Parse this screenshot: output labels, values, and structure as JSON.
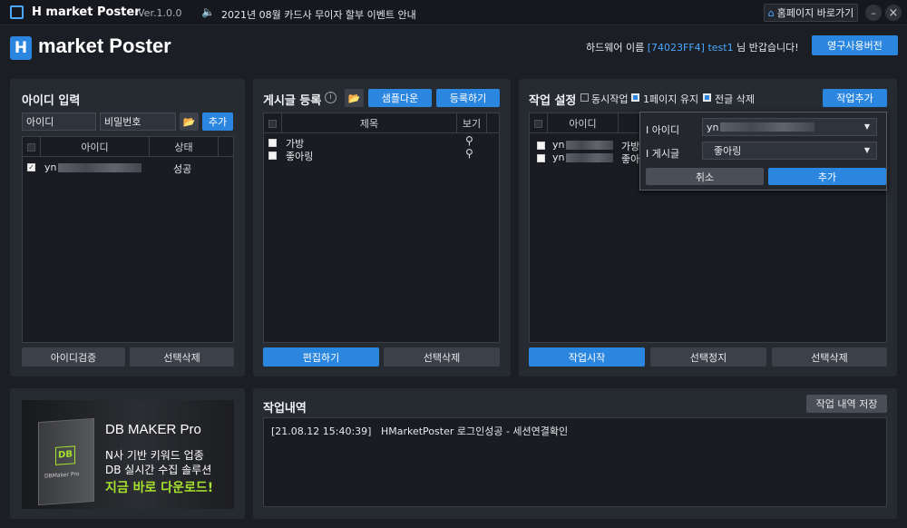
{
  "titlebar": {
    "app_name": "H market Poster",
    "version": "Ver.1.0.0",
    "notice": "2021년 08월 카드사 무이자 할부 이벤트 안내",
    "homepage_button": "홈페이지 바로가기",
    "minimize": "–",
    "close": "×"
  },
  "header": {
    "logo_text": "market Poster",
    "hardware_label": "하드웨어 이름",
    "hardware_id": "[74023FF4]",
    "username": "test1",
    "greeting": "님 반갑습니다!",
    "license_button": "영구사용버전"
  },
  "id_panel": {
    "title": "아이디 입력",
    "id_placeholder": "아이디",
    "pw_placeholder": "비밀번호",
    "add_button": "추가",
    "columns": [
      "아이디",
      "상태"
    ],
    "rows": [
      {
        "id": "yn",
        "status": "성공",
        "checked": true
      }
    ],
    "verify_button": "아이디검증",
    "delete_button": "선택삭제"
  },
  "post_panel": {
    "title": "게시글 등록",
    "sample_button": "샘플다운",
    "register_button": "등록하기",
    "columns": [
      "제목",
      "보기"
    ],
    "rows": [
      "가방",
      "좋아링"
    ],
    "edit_button": "편집하기",
    "delete_button": "선택삭제"
  },
  "task_panel": {
    "title": "작업 설정",
    "options": [
      {
        "label": "동시작업",
        "checked": false
      },
      {
        "label": "1페이지 유지",
        "checked": true
      },
      {
        "label": "전글 삭제",
        "checked": true
      }
    ],
    "add_task_button": "작업추가",
    "columns": [
      "아이디"
    ],
    "rows": [
      {
        "id": "yn",
        "post": "가방"
      },
      {
        "id": "yn",
        "post": "좋아"
      }
    ],
    "popup": {
      "id_label": "I 아이디",
      "id_value": "yn",
      "post_label": "I 게시글",
      "post_value": "좋아링",
      "cancel": "취소",
      "add": "추가"
    },
    "start_button": "작업시작",
    "stop_button": "선택정지",
    "delete_button": "선택삭제"
  },
  "ad": {
    "product": "DB MAKER Pro",
    "line1": "N사 기반 키워드 업종",
    "line2": "DB 실시간 수집 솔루션",
    "cta": "지금 바로 다운로드!",
    "box_label": "DB",
    "box_sub": "DBMaker Pro"
  },
  "log_panel": {
    "title": "작업내역",
    "save_button": "작업 내역 저장",
    "entries": [
      {
        "time": "[21.08.12 15:40:39]",
        "message": "HMarketPoster 로그인성공 - 세션연결확인"
      }
    ]
  },
  "colors": {
    "accent": "#2b86e0",
    "background": "#1b1e24",
    "panel": "#262a31",
    "highlight": "#4aa8ff",
    "ad_green": "#a6e22e"
  }
}
